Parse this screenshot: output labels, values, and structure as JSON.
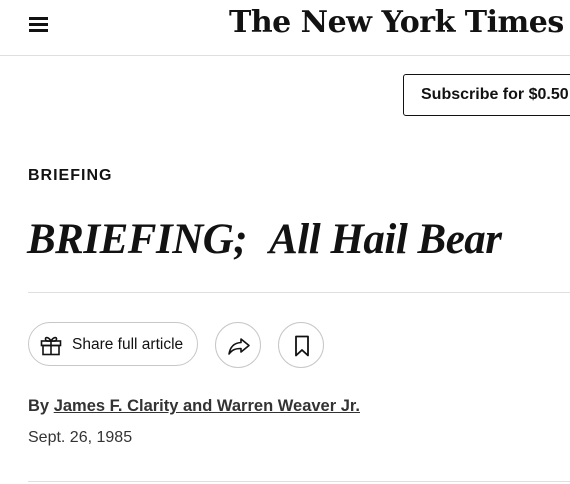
{
  "header": {
    "menu_icon": "hamburger-menu-icon",
    "masthead": "The New York Times"
  },
  "subscribe": {
    "label": "Subscribe for $0.50"
  },
  "article": {
    "kicker": "BRIEFING",
    "headline_part1": "BRIEFING;",
    "headline_part2": "All Hail Bear",
    "share_tools": {
      "gift_label": "Share full article",
      "gift_icon": "gift-icon",
      "share_icon": "share-arrow-icon",
      "save_icon": "bookmark-icon"
    },
    "byline_prefix": "By",
    "authors": "James F. Clarity and Warren Weaver Jr.",
    "date": "Sept. 26, 1985"
  }
}
